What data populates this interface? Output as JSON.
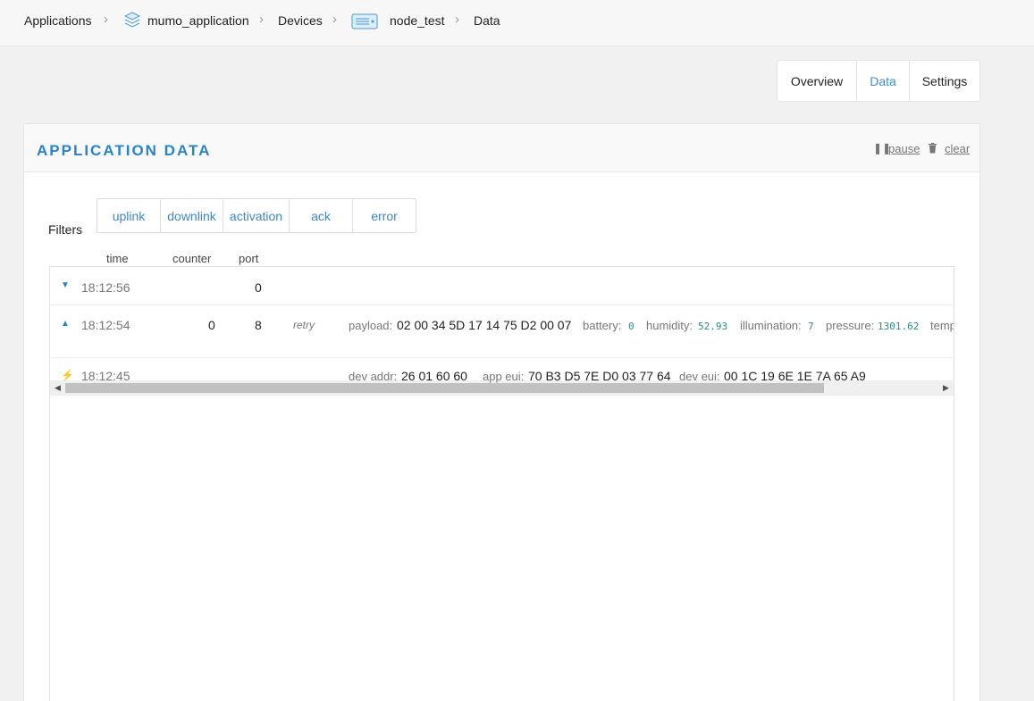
{
  "breadcrumb": {
    "applications": "Applications",
    "application": "mumo_application",
    "devices": "Devices",
    "device": "node_test",
    "data": "Data"
  },
  "tabs": [
    {
      "label": "Overview",
      "active": false
    },
    {
      "label": "Data",
      "active": true
    },
    {
      "label": "Settings",
      "active": false
    }
  ],
  "panel": {
    "title": "APPLICATION DATA",
    "pause": "pause",
    "clear": "clear"
  },
  "filters": {
    "label": "Filters",
    "items": [
      "uplink",
      "downlink",
      "activation",
      "ack",
      "error"
    ]
  },
  "columns": {
    "time": "time",
    "counter": "counter",
    "port": "port"
  },
  "rows": [
    {
      "type": "downlink",
      "icon": "arrow-down-icon",
      "time": "18:12:56",
      "port": "0"
    },
    {
      "type": "uplink",
      "icon": "arrow-up-icon",
      "time": "18:12:54",
      "counter": "0",
      "port": "8",
      "retry": "retry",
      "payload_label": "payload:",
      "payload": "02 00 34 5D 17 14 75 D2 00 07",
      "battery_label": "battery:",
      "battery": "0",
      "humidity_label": "humidity:",
      "humidity": "52.93",
      "illumination_label": "illumination:",
      "illumination": "7",
      "pressure_label": "pressure:",
      "pressure": "1301.62",
      "temp_label": "temp"
    },
    {
      "type": "activation",
      "icon": "lightning-icon",
      "time": "18:12:45",
      "devaddr_label": "dev addr:",
      "devaddr": "26 01 60 60",
      "appeui_label": "app eui:",
      "appeui": "70 B3 D5 7E D0 03 77 64",
      "deveui_label": "dev eui:",
      "deveui": "00 1C 19 6E 1E 7A 65 A9"
    }
  ],
  "colors": {
    "accent": "#2a83c6",
    "value_mono": "#2e8a86",
    "activation": "#f0ad3b"
  }
}
